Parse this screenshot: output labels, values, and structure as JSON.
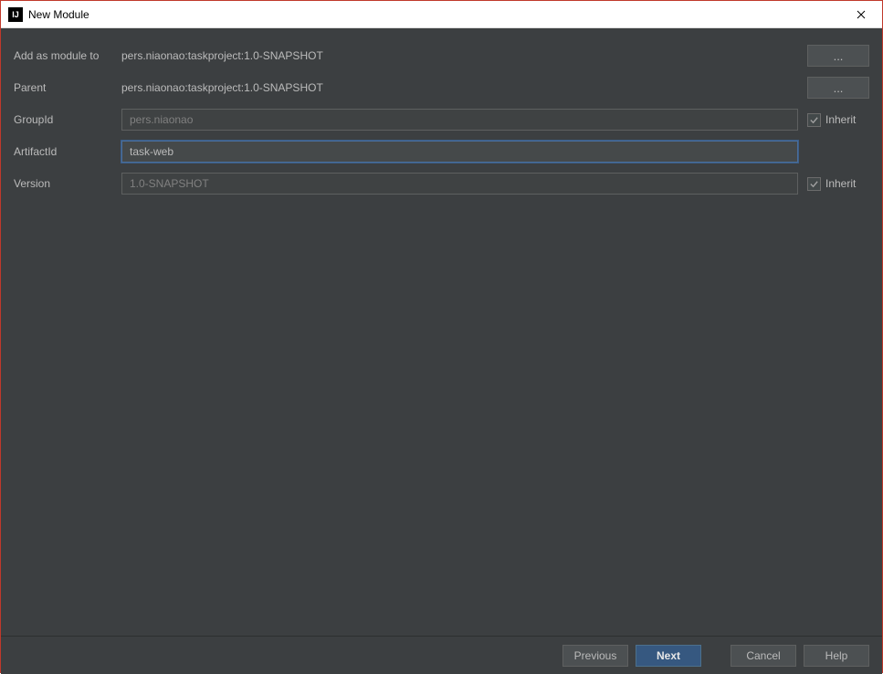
{
  "window": {
    "title": "New Module",
    "icon_label": "IJ"
  },
  "form": {
    "add_module_to": {
      "label": "Add as module to",
      "value": "pers.niaonao:taskproject:1.0-SNAPSHOT",
      "browse": "..."
    },
    "parent": {
      "label": "Parent",
      "value": "pers.niaonao:taskproject:1.0-SNAPSHOT",
      "browse": "..."
    },
    "group_id": {
      "label": "GroupId",
      "value": "pers.niaonao",
      "inherit_label": "Inherit"
    },
    "artifact_id": {
      "label": "ArtifactId",
      "value": "task-web"
    },
    "version": {
      "label": "Version",
      "value": "1.0-SNAPSHOT",
      "inherit_label": "Inherit"
    }
  },
  "buttons": {
    "previous": "Previous",
    "next": "Next",
    "cancel": "Cancel",
    "help": "Help"
  }
}
